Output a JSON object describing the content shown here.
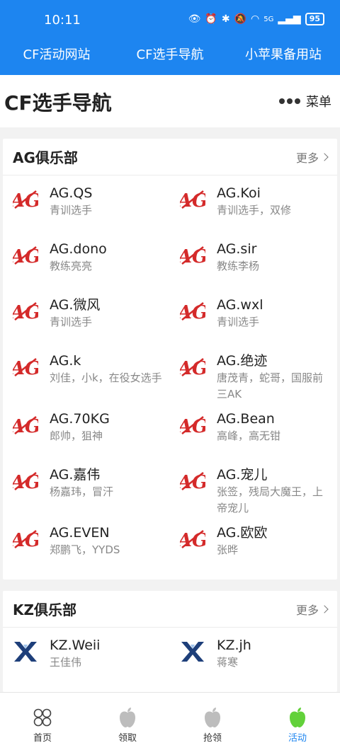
{
  "status": {
    "time": "10:11",
    "battery": "95",
    "signal": "5G"
  },
  "topnav": [
    {
      "label": "CF活动网站"
    },
    {
      "label": "CF选手导航"
    },
    {
      "label": "小苹果备用站"
    }
  ],
  "page": {
    "title": "CF选手导航",
    "menu_label": "菜单"
  },
  "sections": [
    {
      "title": "AG俱乐部",
      "more": "更多",
      "players": [
        {
          "name": "AG.QS",
          "desc": "青训选手"
        },
        {
          "name": "AG.Koi",
          "desc": "青训选手，双修"
        },
        {
          "name": "AG.dono",
          "desc": "教练亮亮"
        },
        {
          "name": "AG.sir",
          "desc": "教练李杨"
        },
        {
          "name": "AG.微风",
          "desc": "青训选手"
        },
        {
          "name": "AG.wxl",
          "desc": "青训选手"
        },
        {
          "name": "AG.k",
          "desc": "刘佳，小k，在役女选手"
        },
        {
          "name": "AG.绝迹",
          "desc": "唐茂青，蛇哥，国服前三AK"
        },
        {
          "name": "AG.70KG",
          "desc": "郎帅，狙神"
        },
        {
          "name": "AG.Bean",
          "desc": "高峰，高无钳"
        },
        {
          "name": "AG.嘉伟",
          "desc": "杨嘉玮，冒汗"
        },
        {
          "name": "AG.宠儿",
          "desc": "张签，残局大魔王，上帝宠儿"
        },
        {
          "name": "AG.EVEN",
          "desc": "郑鹏飞，YYDS"
        },
        {
          "name": "AG.欧欧",
          "desc": "张晔"
        }
      ]
    },
    {
      "title": "KZ俱乐部",
      "more": "更多",
      "players": [
        {
          "name": "KZ.Weii",
          "desc": "王佳伟"
        },
        {
          "name": "KZ.jh",
          "desc": "蒋寒"
        }
      ]
    }
  ],
  "tabs": [
    {
      "label": "首页",
      "icon": "grid-icon"
    },
    {
      "label": "领取",
      "icon": "apple-gray-icon"
    },
    {
      "label": "抢领",
      "icon": "apple-gray-icon"
    },
    {
      "label": "活动",
      "icon": "apple-green-icon",
      "active": true
    }
  ],
  "colors": {
    "primary": "#1d85f0",
    "ag_red": "#d42a2a",
    "kz_blue": "#1e3f7a",
    "active_apple": "#62d13a"
  }
}
